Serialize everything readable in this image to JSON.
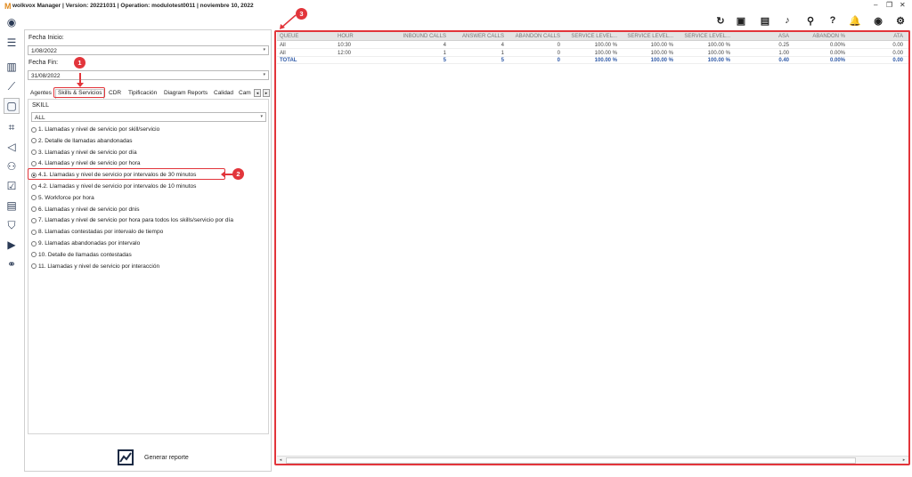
{
  "window": {
    "logo": "M",
    "title": "wolkvox Manager  | Version: 20221031 |  Operation: modulotest0011 | noviembre 10, 2022",
    "minimize": "–",
    "restore": "❐",
    "close": "✕"
  },
  "toolbar": {
    "icons": [
      "refresh-icon",
      "report-copy-icon",
      "id-card-icon",
      "music-note-icon",
      "microphone-icon",
      "help-icon",
      "bell-icon",
      "user-icon",
      "settings-icon"
    ],
    "glyphs": [
      "↻",
      "▣",
      "▤",
      "♪",
      "⚲",
      "?",
      "🔔",
      "◉",
      "⚙"
    ]
  },
  "rail": {
    "icons": [
      "avatar-icon",
      "menu-icon",
      "bar-chart-icon",
      "trend-icon",
      "report-icon",
      "hierarchy-icon",
      "campaign-icon",
      "group-icon",
      "checklist-icon",
      "document-icon",
      "shield-icon",
      "video-add-icon",
      "voicemail-icon"
    ],
    "glyphs": [
      "◉",
      "☰",
      "▥",
      "⟋",
      "▢",
      "⌗",
      "◁",
      "⚇",
      "☑",
      "▤",
      "⛉",
      "▶",
      "⚭"
    ]
  },
  "filters": {
    "start_label": "Fecha Inicio:",
    "start_value": "1/08/2022",
    "end_label": "Fecha Fin:",
    "end_value": "31/08/2022",
    "dropdown_arrow": "▾"
  },
  "tabs": {
    "items": [
      "Agentes",
      "Skills & Servicios",
      "CDR",
      "Tipificación",
      "Diagram Reports",
      "Calidad",
      "Cam"
    ],
    "selected": "Skills & Servicios",
    "prev": "◂",
    "next": "▸"
  },
  "skill": {
    "label": "SKILL",
    "value": "ALL"
  },
  "reports": [
    "1. Llamadas y nivel de servicio por skill/servicio",
    "2. Detalle de llamadas abandonadas",
    "3. Llamadas y nivel de servicio por día",
    "4. Llamadas y nivel de servicio por hora",
    "4.1. Llamadas y nivel de servicio por intervalos de 30 minutos",
    "4.2. Llamadas y nivel de servicio por intervalos de 10 minutos",
    "5. Workforce por hora",
    "6. Llamadas y nivel de servicio por dnis",
    "7. Llamadas y nivel de servicio por hora para todos los skills/servicio por día",
    "8. Llamadas contestadas por intervalo de tiempo",
    "9. Llamadas abandonadas por intervalo",
    "10. Detalle de llamadas contestadas",
    "11. Llamadas y nivel de servicio por interacción"
  ],
  "selected_report_index": 4,
  "generate": {
    "label": "Generar reporte"
  },
  "table": {
    "headers": [
      "QUEUE",
      "HOUR",
      "INBOUND CALLS",
      "ANSWER CALLS",
      "ABANDON CALLS",
      "SERVICE LEVEL...",
      "SERVICE LEVEL...",
      "SERVICE LEVEL...",
      "ASA",
      "ABANDON %",
      "ATA"
    ],
    "rows": [
      [
        "All",
        "10:30",
        "4",
        "4",
        "0",
        "100.00 %",
        "100.00 %",
        "100.00 %",
        "0.25",
        "0.00%",
        "0.00"
      ],
      [
        "All",
        "12:00",
        "1",
        "1",
        "0",
        "100.00 %",
        "100.00 %",
        "100.00 %",
        "1.00",
        "0.00%",
        "0.00"
      ]
    ],
    "total": [
      "TOTAL",
      "",
      "5",
      "5",
      "0",
      "100.00 %",
      "100.00 %",
      "100.00 %",
      "0.40",
      "0.00%",
      "0.00"
    ],
    "scroll_left": "◂",
    "scroll_right": "▸"
  },
  "annotations": {
    "badges": [
      "1",
      "2",
      "3"
    ],
    "color": "#e2353b"
  }
}
